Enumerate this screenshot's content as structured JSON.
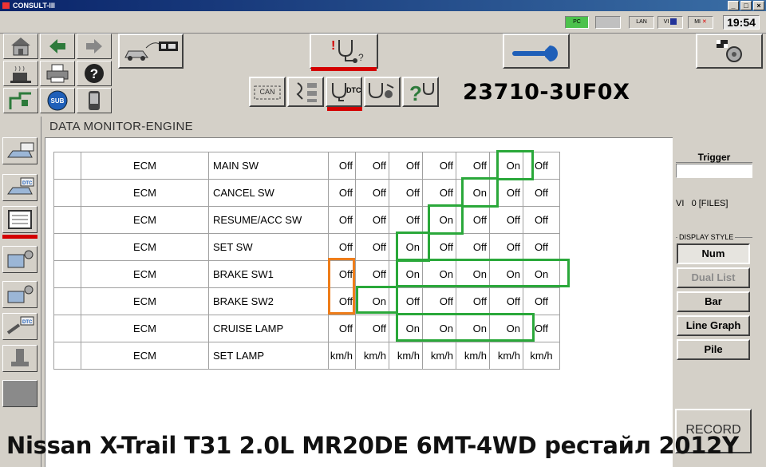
{
  "window": {
    "title": "CONSULT-III"
  },
  "status": {
    "pc": "PC",
    "lan": "LAN",
    "vi": "VI",
    "mi": "MI",
    "time": "19:54"
  },
  "header": {
    "part_number": "23710-3UF0X",
    "can_label": "CAN",
    "dtc_label": "DTC"
  },
  "nav": {
    "sub_label": "SUB"
  },
  "main": {
    "title": "DATA MONITOR-ENGINE"
  },
  "table": {
    "rows": [
      {
        "system": "ECM",
        "item": "MAIN SW",
        "values": [
          "Off",
          "Off",
          "Off",
          "Off",
          "Off",
          "On",
          "Off"
        ]
      },
      {
        "system": "ECM",
        "item": "CANCEL SW",
        "values": [
          "Off",
          "Off",
          "Off",
          "Off",
          "On",
          "Off",
          "Off"
        ]
      },
      {
        "system": "ECM",
        "item": "RESUME/ACC SW",
        "values": [
          "Off",
          "Off",
          "Off",
          "On",
          "Off",
          "Off",
          "Off"
        ]
      },
      {
        "system": "ECM",
        "item": "SET SW",
        "values": [
          "Off",
          "Off",
          "On",
          "Off",
          "Off",
          "Off",
          "Off"
        ]
      },
      {
        "system": "ECM",
        "item": "BRAKE SW1",
        "values": [
          "Off",
          "Off",
          "On",
          "On",
          "On",
          "On",
          "On"
        ]
      },
      {
        "system": "ECM",
        "item": "BRAKE SW2",
        "values": [
          "Off",
          "On",
          "Off",
          "Off",
          "Off",
          "Off",
          "Off"
        ]
      },
      {
        "system": "ECM",
        "item": "CRUISE LAMP",
        "values": [
          "Off",
          "Off",
          "On",
          "On",
          "On",
          "On",
          "Off"
        ]
      },
      {
        "system": "ECM",
        "item": "SET LAMP",
        "values": [
          "km/h",
          "km/h",
          "km/h",
          "km/h",
          "km/h",
          "km/h",
          "km/h"
        ]
      }
    ]
  },
  "right": {
    "trigger_label": "Trigger",
    "vi_label": "VI",
    "files": "0 [FILES]",
    "display_style_label": "DISPLAY STYLE",
    "num": "Num",
    "dual_list": "Dual List",
    "bar": "Bar",
    "line_graph": "Line Graph",
    "pile": "Pile",
    "record": "RECORD"
  },
  "caption": "Nissan X-Trail T31 2.0L MR20DE 6MT-4WD рестайл 2012Y",
  "colors": {
    "highlight_green": "#2aa83a",
    "highlight_orange": "#ee7d1a",
    "active_red": "#d40000"
  }
}
